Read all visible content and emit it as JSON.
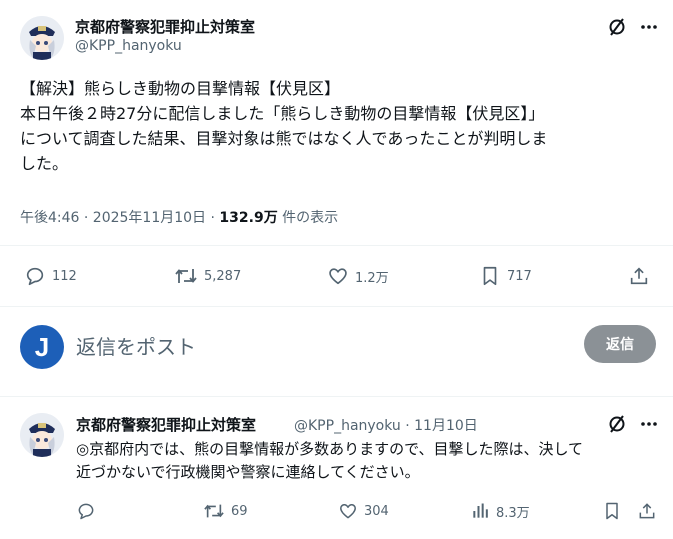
{
  "post": {
    "author_name": "京都府警察犯罪抑止対策室",
    "author_handle": "@KPP_hanyoku",
    "text_lines": [
      "【解決】熊らしき動物の目撃情報【伏見区】",
      "本日午後２時27分に配信しました「熊らしき動物の目撃情報【伏見区】」",
      "について調査した結果、目撃対象は熊ではなく人であったことが判明しま",
      "した。"
    ],
    "timestamp": "午後4:46 · 2025年11月10日 ·",
    "views_count": "132.9万",
    "views_label": "件の表示",
    "stats": {
      "replies": "112",
      "reposts": "5,287",
      "likes": "1.2万",
      "bookmarks": "717"
    }
  },
  "reply_composer": {
    "placeholder": "返信をポスト",
    "button_label": "返信",
    "avatar_letter": "J"
  },
  "reply": {
    "author_name": "京都府警察犯罪抑止対策室",
    "author_handle_time": "@KPP_hanyoku · 11月10日",
    "text_lines": [
      "◎京都府内では、熊の目撃情報が多数ありますので、目撃した際は、決して",
      "近づかないで行政機関や警察に連絡してください。"
    ],
    "stats": {
      "reposts": "69",
      "likes": "304",
      "views": "8.3万"
    }
  },
  "colors": {
    "text_primary": "#0f1419",
    "text_secondary": "#536471",
    "reply_button_bg": "#8b9196",
    "composer_avatar_bg": "#1d5fb8"
  },
  "icons": [
    "avatar-mascot",
    "grok-icon",
    "more-icon",
    "reply-icon",
    "repost-icon",
    "like-icon",
    "bookmark-icon",
    "share-icon",
    "views-icon"
  ]
}
